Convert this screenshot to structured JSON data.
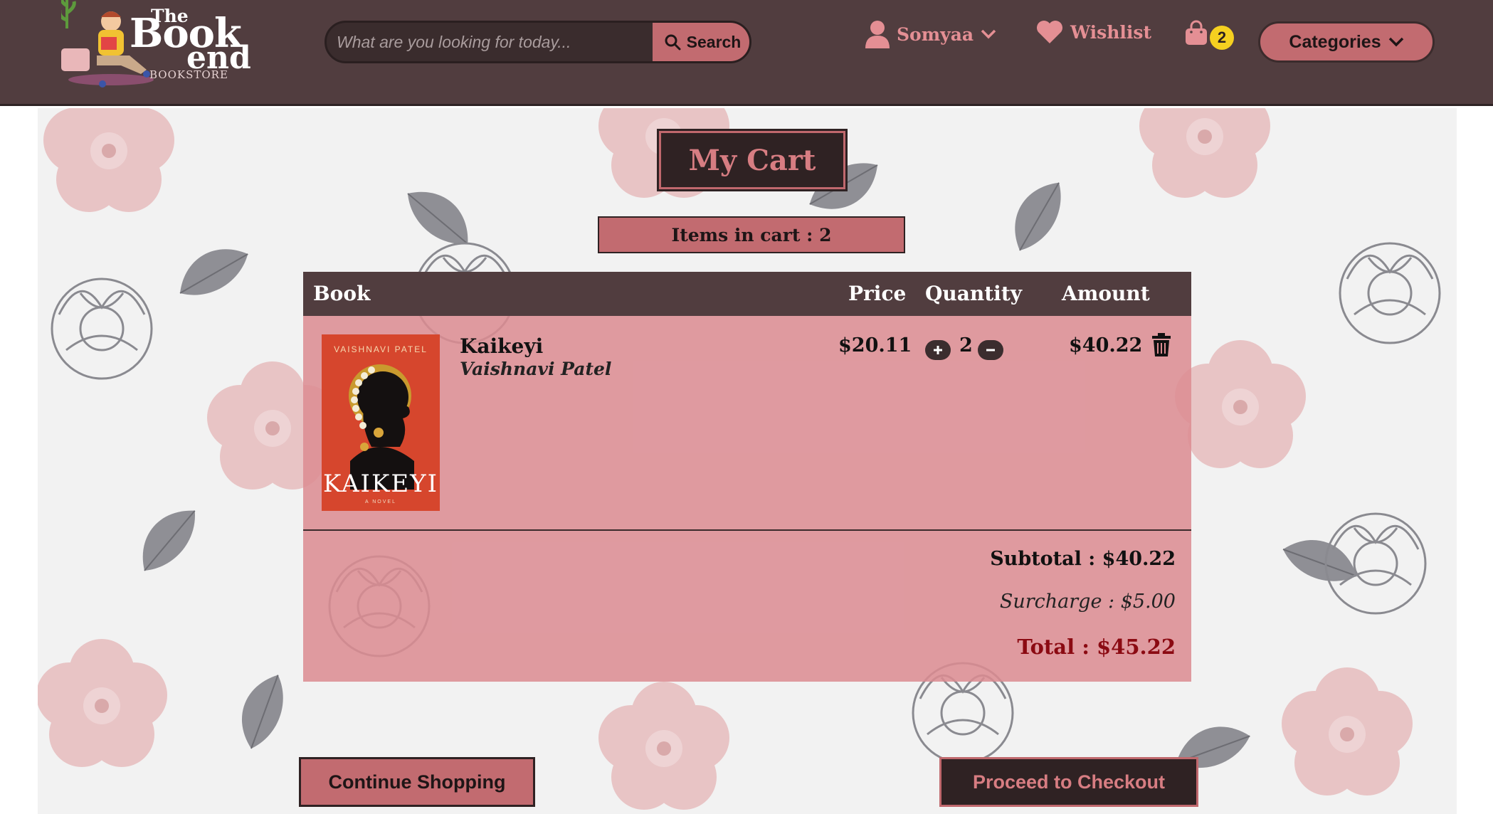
{
  "header": {
    "logo": {
      "line1": "The",
      "line2": "Book",
      "line3": "end",
      "line4": "BOOKSTORE"
    },
    "search": {
      "placeholder": "What are you looking for today...",
      "button_label": "Search",
      "button_icon": "search-icon"
    },
    "user": {
      "name": "Somyaa",
      "icon": "user-icon"
    },
    "wishlist": {
      "label": "Wishlist",
      "icon": "heart-icon"
    },
    "cart": {
      "icon": "shopping-bag-icon",
      "count": "2"
    },
    "categories_label": "Categories"
  },
  "cart": {
    "title": "My Cart",
    "items_count_text": "Items in cart : 2",
    "columns": {
      "book": "Book",
      "price": "Price",
      "quantity": "Quantity",
      "amount": "Amount"
    },
    "items": [
      {
        "title": "Kaikeyi",
        "author": "Vaishnavi Patel",
        "cover": {
          "author": "VAISHNAVI PATEL",
          "title": "KAIKEYI",
          "subtitle": "A NOVEL"
        },
        "price": "$20.11",
        "quantity": "2",
        "amount": "$40.22",
        "remove_icon": "trash-icon"
      }
    ],
    "subtotal_text": "Subtotal : $40.22",
    "surcharge_text": "Surcharge : $5.00",
    "total_text": "Total : $45.22"
  },
  "actions": {
    "continue_label": "Continue Shopping",
    "checkout_label": "Proceed to Checkout"
  },
  "colors": {
    "header_bg": "#513d3f",
    "accent_pink": "#c26b70",
    "dark": "#2f2223",
    "total_red": "#8b0a12",
    "badge_yellow": "#f5d020"
  }
}
